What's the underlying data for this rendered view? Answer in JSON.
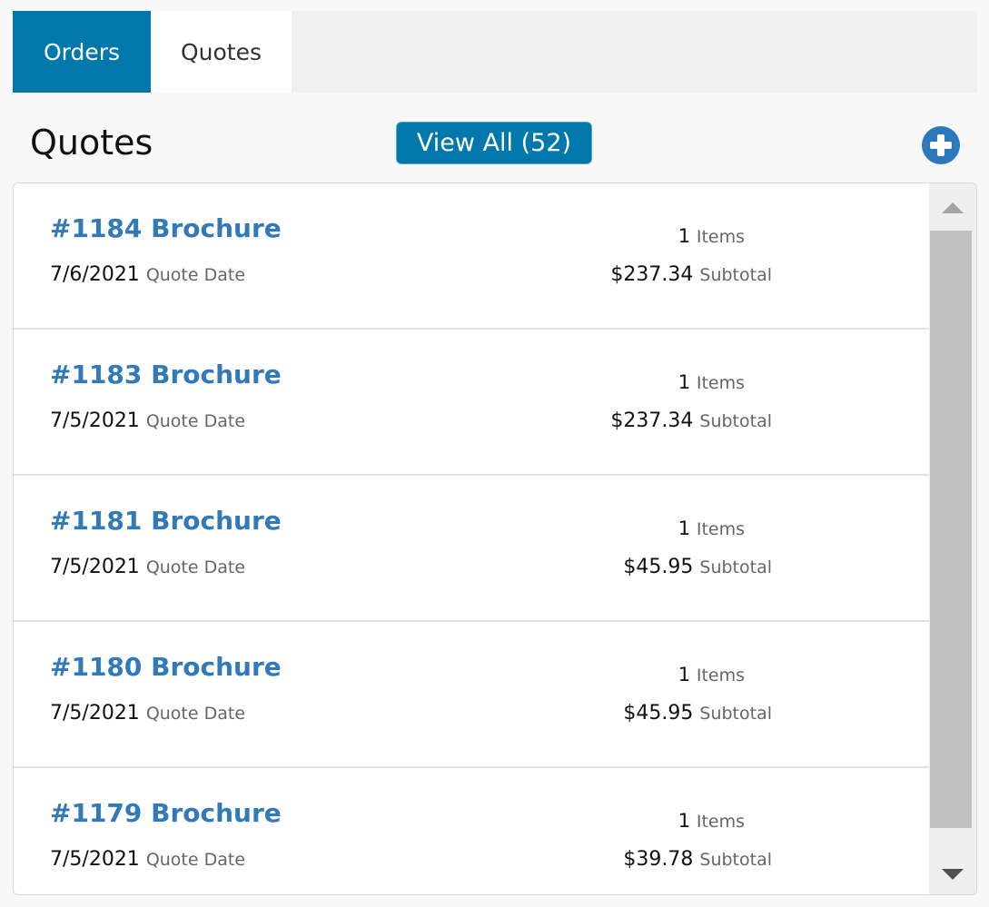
{
  "tabs": {
    "orders_label": "Orders",
    "quotes_label": "Quotes"
  },
  "header": {
    "title": "Quotes",
    "view_all_label": "View All (52)",
    "add_icon": "plus-circle-icon"
  },
  "labels": {
    "items": "Items",
    "quote_date": "Quote Date",
    "subtotal": "Subtotal"
  },
  "quotes": [
    {
      "title": "#1184 Brochure",
      "date": "7/6/2021",
      "items": "1",
      "subtotal": "$237.34"
    },
    {
      "title": "#1183 Brochure",
      "date": "7/5/2021",
      "items": "1",
      "subtotal": "$237.34"
    },
    {
      "title": "#1181 Brochure",
      "date": "7/5/2021",
      "items": "1",
      "subtotal": "$45.95"
    },
    {
      "title": "#1180 Brochure",
      "date": "7/5/2021",
      "items": "1",
      "subtotal": "$45.95"
    },
    {
      "title": "#1179 Brochure",
      "date": "7/5/2021",
      "items": "1",
      "subtotal": "$39.78"
    }
  ],
  "colors": {
    "accent": "#0178ac",
    "link": "#3279b7",
    "add_button": "#2b78bd"
  }
}
